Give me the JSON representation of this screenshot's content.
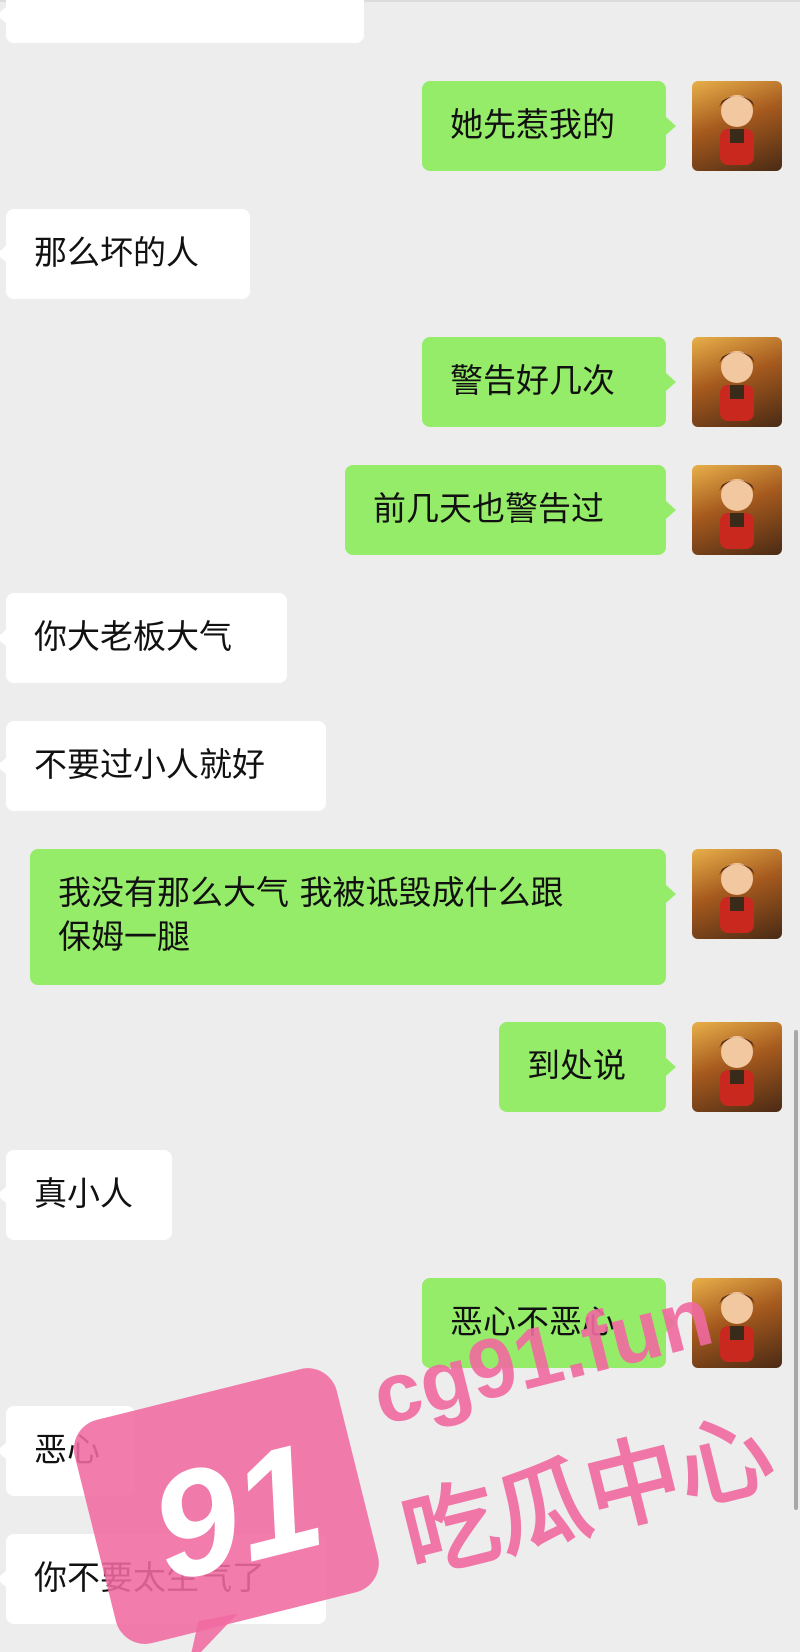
{
  "messages": [
    {
      "side": "in",
      "text": ""
    },
    {
      "side": "out",
      "text": "她先惹我的"
    },
    {
      "side": "in",
      "text": "那么坏的人"
    },
    {
      "side": "out",
      "text": "警告好几次"
    },
    {
      "side": "out",
      "text": "前几天也警告过"
    },
    {
      "side": "in",
      "text": "你大老板大气"
    },
    {
      "side": "in",
      "text": "不要过小人就好"
    },
    {
      "side": "out",
      "text": "我没有那么大气 我被诋毁成什么跟\n保姆一腿"
    },
    {
      "side": "out",
      "text": "到处说"
    },
    {
      "side": "in",
      "text": "真小人"
    },
    {
      "side": "out",
      "text": "恶心不恶心"
    },
    {
      "side": "in",
      "text": "恶心"
    },
    {
      "side": "in",
      "text": "你不要太生气了"
    }
  ],
  "watermark": {
    "number": "91",
    "domain": "cg91.fun",
    "brand": "吃瓜中心",
    "color": "#f06aa0"
  },
  "icons": {
    "avatar": "avatar-cartoon-boy"
  }
}
